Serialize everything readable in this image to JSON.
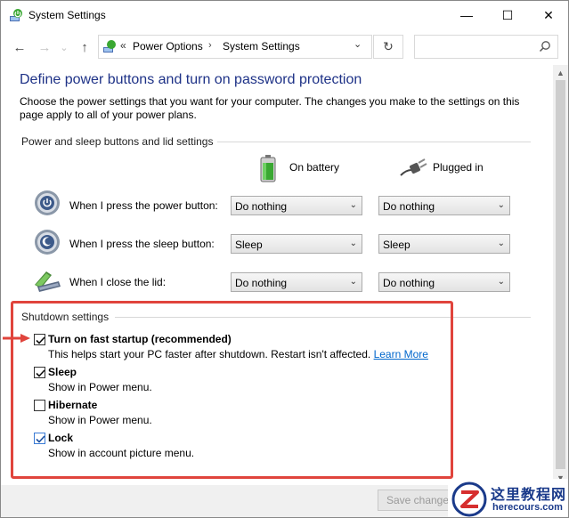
{
  "window": {
    "title": "System Settings",
    "controls": {
      "minimize": "—",
      "maximize": "☐",
      "close": "✕"
    }
  },
  "addressbar": {
    "back_icon": "←",
    "forward_icon": "→",
    "recent_icon": "⌄",
    "up_icon": "↑",
    "chevron": "«",
    "crumbs": [
      "Power Options",
      "System Settings"
    ],
    "separator": "›",
    "dropdown_icon": "⌄",
    "refresh_icon": "↻",
    "search_placeholder": ""
  },
  "page": {
    "heading": "Define power buttons and turn on password protection",
    "description": "Choose the power settings that you want for your computer. The changes you make to the settings on this page apply to all of your power plans.",
    "power_section_label": "Power and sleep buttons and lid settings",
    "columns": {
      "battery": "On battery",
      "plugged": "Plugged in"
    },
    "rows": [
      {
        "label": "When I press the power button:",
        "battery": "Do nothing",
        "plugged": "Do nothing",
        "icon": "power-button-icon"
      },
      {
        "label": "When I press the sleep button:",
        "battery": "Sleep",
        "plugged": "Sleep",
        "icon": "sleep-button-icon"
      },
      {
        "label": "When I close the lid:",
        "battery": "Do nothing",
        "plugged": "Do nothing",
        "icon": "laptop-lid-icon"
      }
    ],
    "dropdown_arrow": "⌄",
    "shutdown_section_label": "Shutdown settings",
    "shutdown": [
      {
        "title": "Turn on fast startup (recommended)",
        "desc": "This helps start your PC faster after shutdown. Restart isn't affected.",
        "link": "Learn More",
        "checked": true
      },
      {
        "title": "Sleep",
        "desc": "Show in Power menu.",
        "checked": true
      },
      {
        "title": "Hibernate",
        "desc": "Show in Power menu.",
        "checked": false
      },
      {
        "title": "Lock",
        "desc": "Show in account picture menu.",
        "checked": true
      }
    ]
  },
  "footer": {
    "save_label": "Save changes"
  },
  "watermark": {
    "cn": "这里教程网",
    "en": "herecours.com"
  },
  "colors": {
    "heading": "#1e3287",
    "highlight": "#e0443c",
    "link": "#0066cc"
  }
}
